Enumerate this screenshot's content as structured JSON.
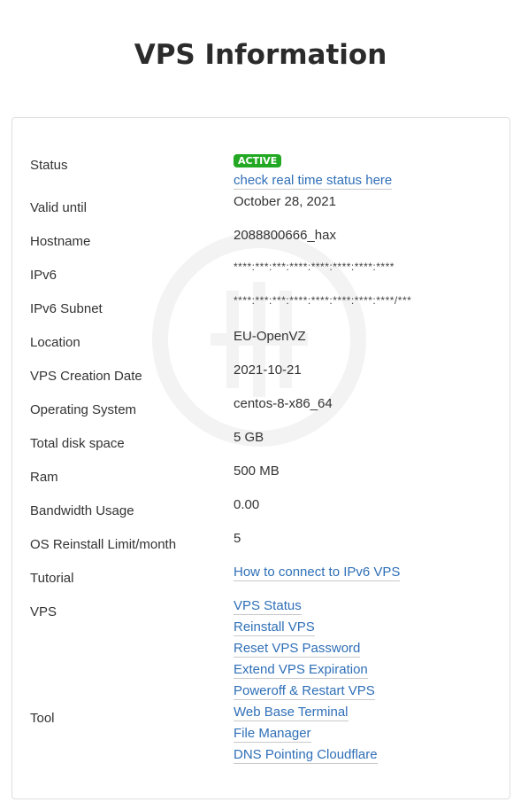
{
  "page": {
    "title": "VPS Information"
  },
  "status": {
    "label": "Status",
    "badge": "ACTIVE",
    "badge_color": "#22a822",
    "link": "check real time status here"
  },
  "rows": {
    "valid_until": {
      "label": "Valid until",
      "value": "October 28, 2021"
    },
    "hostname": {
      "label": "Hostname",
      "value": "2088800666_hax"
    },
    "ipv6": {
      "label": "IPv6",
      "value": "****:***:***:****:****:****:****:****"
    },
    "ipv6_subnet": {
      "label": "IPv6 Subnet",
      "value": "****:***:***:****:****:****:****:****/***"
    },
    "location": {
      "label": "Location",
      "value": "EU-OpenVZ"
    },
    "creation_date": {
      "label": "VPS Creation Date",
      "value": "2021-10-21"
    },
    "os": {
      "label": "Operating System",
      "value": "centos-8-x86_64"
    },
    "disk": {
      "label": "Total disk space",
      "value": "5 GB"
    },
    "ram": {
      "label": "Ram",
      "value": "500 MB"
    },
    "bandwidth": {
      "label": "Bandwidth Usage",
      "value": "0.00"
    },
    "reinstall_limit": {
      "label": "OS Reinstall Limit/month",
      "value": "5"
    }
  },
  "tutorial": {
    "label": "Tutorial",
    "link": "How to connect to IPv6 VPS"
  },
  "vps": {
    "label": "VPS",
    "links": [
      "VPS Status",
      "Reinstall VPS",
      "Reset VPS Password",
      "Extend VPS Expiration",
      "Poweroff & Restart VPS"
    ]
  },
  "tool": {
    "label": "Tool",
    "links": [
      "Web Base Terminal",
      "File Manager",
      "DNS Pointing Cloudflare"
    ]
  },
  "colors": {
    "link": "#2f6fb7",
    "text": "#333333",
    "border": "#dedede"
  }
}
